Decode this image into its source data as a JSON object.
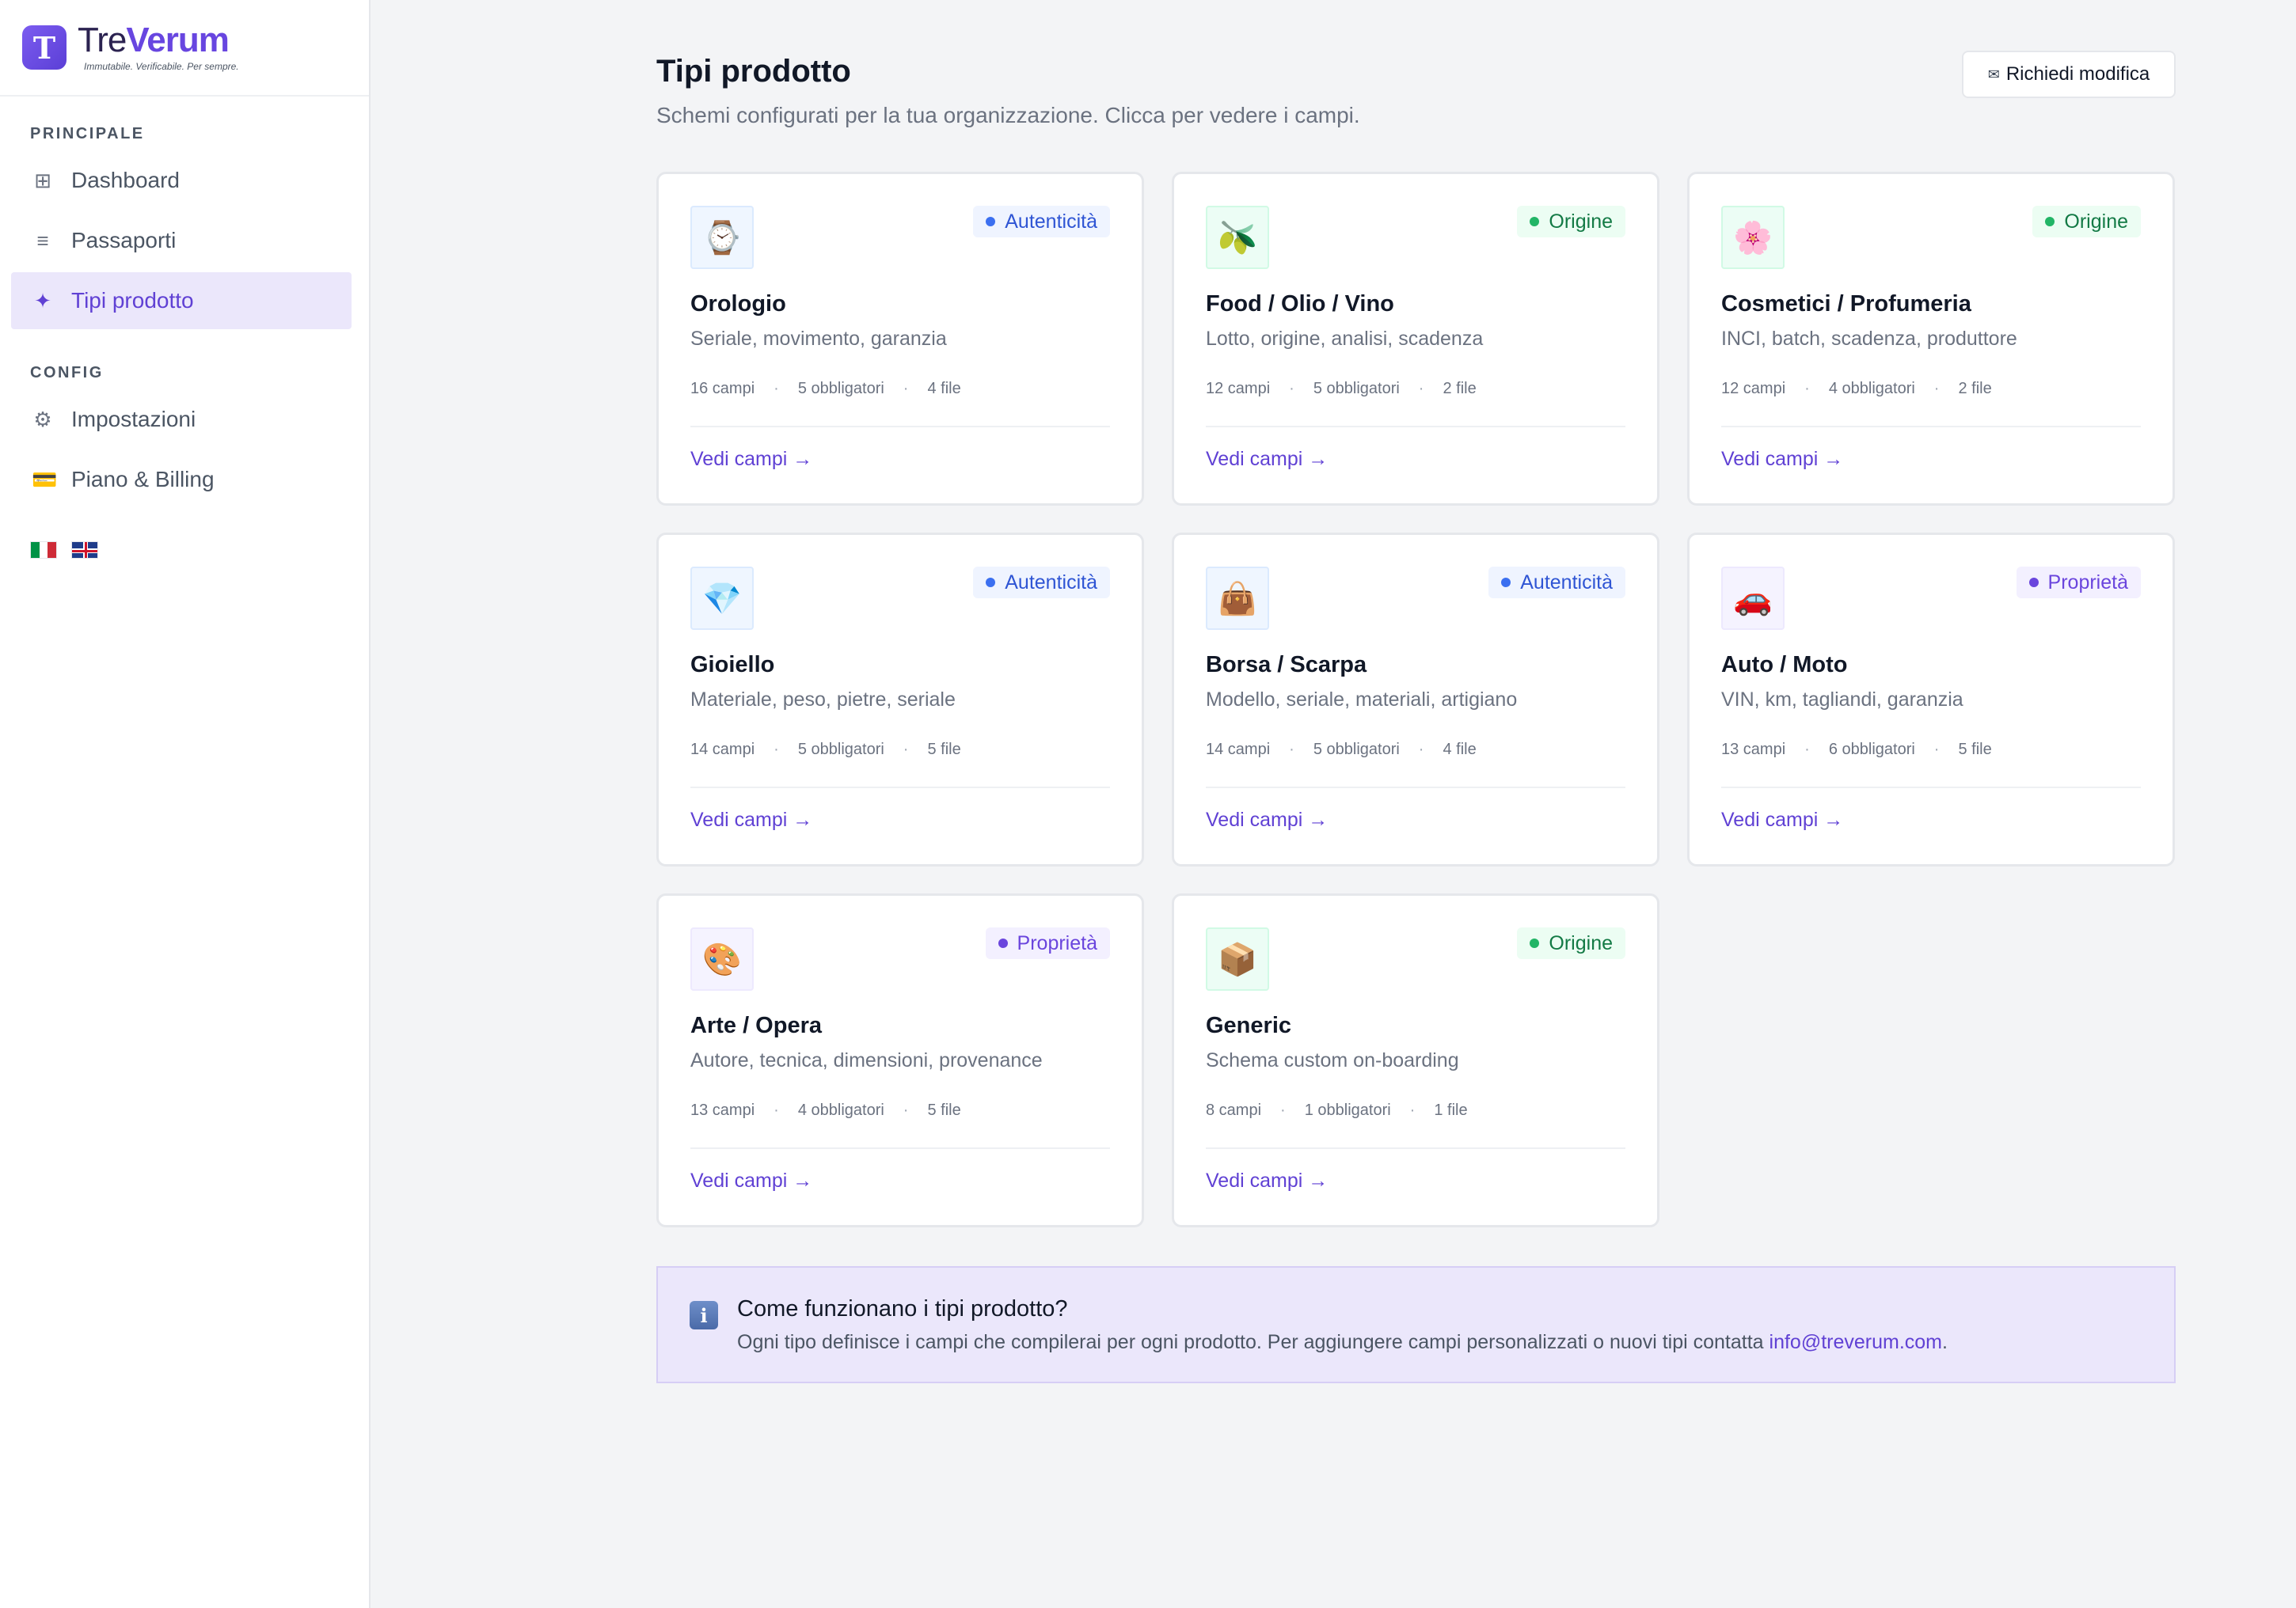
{
  "brand": {
    "logo_letter": "T",
    "name_part1": "Tre",
    "name_part2": "Verum",
    "tagline": "Immutabile. Verificabile. Per sempre."
  },
  "sidebar": {
    "section_main": "PRINCIPALE",
    "section_config": "CONFIG",
    "items": [
      {
        "label": "Dashboard",
        "icon": "grid-icon",
        "glyph": "⊞"
      },
      {
        "label": "Passaporti",
        "icon": "list-icon",
        "glyph": "≡"
      },
      {
        "label": "Tipi prodotto",
        "icon": "sparkle-icon",
        "glyph": "✦",
        "active": true
      },
      {
        "label": "Impostazioni",
        "icon": "gear-icon",
        "glyph": "⚙"
      },
      {
        "label": "Piano & Billing",
        "icon": "credit-card-icon",
        "glyph": "💳"
      }
    ],
    "languages": [
      "it",
      "en"
    ]
  },
  "header": {
    "title": "Tipi prodotto",
    "subtitle": "Schemi configurati per la tua organizzazione. Clicca per vedere i campi.",
    "request_button": "Richiedi modifica",
    "request_icon": "✉"
  },
  "cards": [
    {
      "icon": "⌚",
      "icon_name": "watch-icon",
      "tone": "blue",
      "badge": "Autenticità",
      "title": "Orologio",
      "desc": "Seriale, movimento, garanzia",
      "fields": "16 campi",
      "required": "5 obbligatori",
      "files": "4 file",
      "link": "Vedi campi →"
    },
    {
      "icon": "🫒",
      "icon_name": "olive-icon",
      "tone": "green",
      "badge": "Origine",
      "title": "Food / Olio / Vino",
      "desc": "Lotto, origine, analisi, scadenza",
      "fields": "12 campi",
      "required": "5 obbligatori",
      "files": "2 file",
      "link": "Vedi campi →"
    },
    {
      "icon": "🌸",
      "icon_name": "flower-icon",
      "tone": "green",
      "badge": "Origine",
      "title": "Cosmetici / Profumeria",
      "desc": "INCI, batch, scadenza, produttore",
      "fields": "12 campi",
      "required": "4 obbligatori",
      "files": "2 file",
      "link": "Vedi campi →"
    },
    {
      "icon": "💎",
      "icon_name": "gem-icon",
      "tone": "blue",
      "badge": "Autenticità",
      "title": "Gioiello",
      "desc": "Materiale, peso, pietre, seriale",
      "fields": "14 campi",
      "required": "5 obbligatori",
      "files": "5 file",
      "link": "Vedi campi →"
    },
    {
      "icon": "👜",
      "icon_name": "handbag-icon",
      "tone": "blue",
      "badge": "Autenticità",
      "title": "Borsa / Scarpa",
      "desc": "Modello, seriale, materiali, artigiano",
      "fields": "14 campi",
      "required": "5 obbligatori",
      "files": "4 file",
      "link": "Vedi campi →"
    },
    {
      "icon": "🚗",
      "icon_name": "car-icon",
      "tone": "purple",
      "badge": "Proprietà",
      "title": "Auto / Moto",
      "desc": "VIN, km, tagliandi, garanzia",
      "fields": "13 campi",
      "required": "6 obbligatori",
      "files": "5 file",
      "link": "Vedi campi →"
    },
    {
      "icon": "🎨",
      "icon_name": "palette-icon",
      "tone": "purple",
      "badge": "Proprietà",
      "title": "Arte / Opera",
      "desc": "Autore, tecnica, dimensioni, provenance",
      "fields": "13 campi",
      "required": "4 obbligatori",
      "files": "5 file",
      "link": "Vedi campi →"
    },
    {
      "icon": "📦",
      "icon_name": "package-icon",
      "tone": "green",
      "badge": "Origine",
      "title": "Generic",
      "desc": "Schema custom on-boarding",
      "fields": "8 campi",
      "required": "1 obbligatori",
      "files": "1 file",
      "link": "Vedi campi →"
    }
  ],
  "info": {
    "icon": "i",
    "title": "Come funzionano i tipi prodotto?",
    "text": "Ogni tipo definisce i campi che compilerai per ogni prodotto. Per aggiungere campi personalizzati o nuovi tipi contatta ",
    "email": "info@treverum.com",
    "end": "."
  },
  "colors": {
    "accent": "#6041d4",
    "active_bg": "#ebe7fb",
    "page_bg": "#f3f4f6"
  }
}
